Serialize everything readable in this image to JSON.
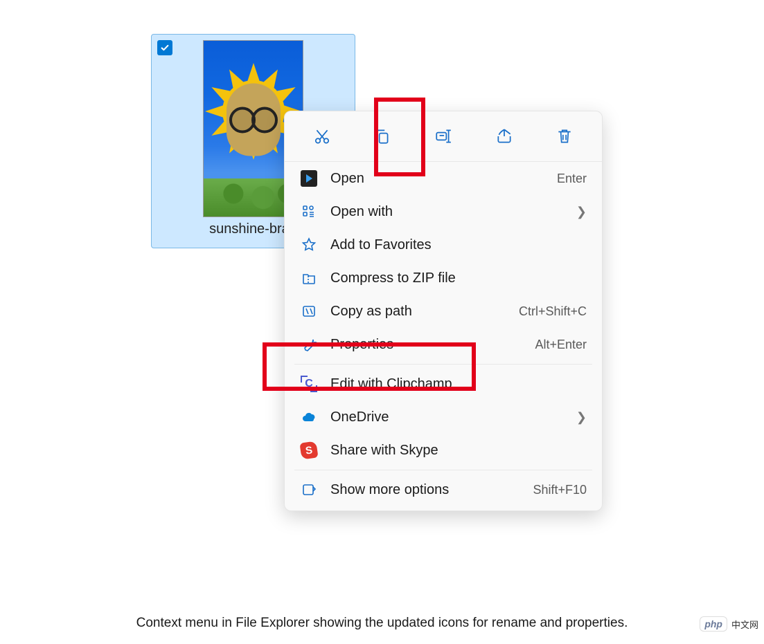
{
  "file": {
    "name": "sunshine-bran",
    "selected": true
  },
  "toolbar": {
    "items": [
      {
        "name": "cut-button",
        "icon": "cut-icon"
      },
      {
        "name": "copy-button",
        "icon": "copy-icon"
      },
      {
        "name": "rename-button",
        "icon": "rename-icon"
      },
      {
        "name": "share-button",
        "icon": "share-icon"
      },
      {
        "name": "delete-button",
        "icon": "delete-icon"
      }
    ]
  },
  "menu": {
    "items": [
      {
        "icon": "open-app-icon",
        "label": "Open",
        "shortcut": "Enter",
        "name": "open"
      },
      {
        "icon": "open-with-icon",
        "label": "Open with",
        "submenu": true,
        "name": "open-with"
      },
      {
        "icon": "favorite-icon",
        "label": "Add to Favorites",
        "name": "add-to-favorites"
      },
      {
        "icon": "zip-icon",
        "label": "Compress to ZIP file",
        "name": "compress-zip"
      },
      {
        "icon": "copy-path-icon",
        "label": "Copy as path",
        "shortcut": "Ctrl+Shift+C",
        "name": "copy-as-path"
      },
      {
        "icon": "properties-icon",
        "label": "Properties",
        "shortcut": "Alt+Enter",
        "name": "properties"
      },
      {
        "separator": true
      },
      {
        "icon": "clipchamp-icon",
        "label": "Edit with Clipchamp",
        "name": "edit-clipchamp"
      },
      {
        "icon": "onedrive-icon",
        "label": "OneDrive",
        "submenu": true,
        "name": "onedrive"
      },
      {
        "icon": "skype-icon",
        "label": "Share with Skype",
        "name": "share-skype"
      },
      {
        "separator": true
      },
      {
        "icon": "more-icon",
        "label": "Show more options",
        "shortcut": "Shift+F10",
        "name": "show-more-options"
      }
    ]
  },
  "caption": "Context menu in File Explorer showing the updated icons for rename and properties.",
  "watermark": {
    "badge": "php",
    "text": "中文网"
  },
  "colors": {
    "accent": "#0078d4",
    "highlight": "#e2001a",
    "selection": "#cde8ff",
    "icon": "#1a6fc9"
  }
}
